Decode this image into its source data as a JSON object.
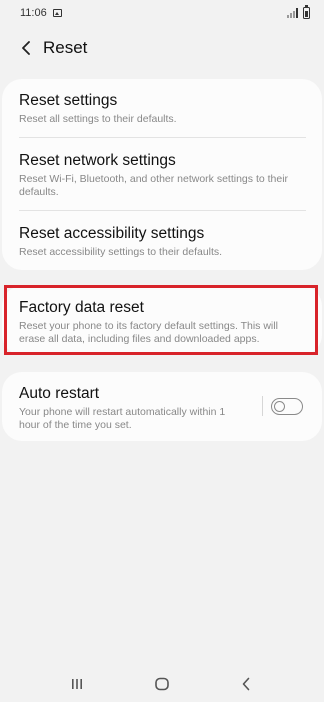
{
  "status_bar": {
    "time": "11:06",
    "icons": [
      "image-notification-icon",
      "signal-icon",
      "battery-icon"
    ]
  },
  "header": {
    "title": "Reset",
    "back_icon": "chevron-left-icon"
  },
  "reset_items": [
    {
      "title": "Reset settings",
      "subtitle": "Reset all settings to their defaults."
    },
    {
      "title": "Reset network settings",
      "subtitle": "Reset Wi-Fi, Bluetooth, and other network settings to their defaults."
    },
    {
      "title": "Reset accessibility settings",
      "subtitle": "Reset accessibility settings to their defaults."
    }
  ],
  "factory_reset": {
    "title": "Factory data reset",
    "subtitle": "Reset your phone to its factory default settings. This will erase all data, including files and downloaded apps."
  },
  "auto_restart": {
    "title": "Auto restart",
    "subtitle": "Your phone will restart automatically within 1 hour of the time you set.",
    "enabled": false
  },
  "nav_bar": {
    "icons": [
      "recents-icon",
      "home-icon",
      "back-icon"
    ]
  },
  "colors": {
    "background": "#f2f2f2",
    "card": "#fcfcfc",
    "highlight": "#d8232a",
    "subtitle_text": "#888888"
  }
}
